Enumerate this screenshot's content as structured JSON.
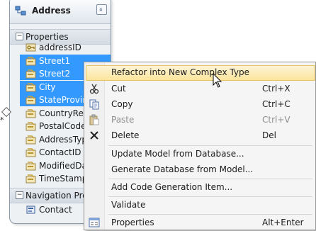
{
  "entity": {
    "title": "Address",
    "collapse_glyph": "»",
    "properties_header": "Properties",
    "navigation_header": "Navigation Prop",
    "properties": [
      {
        "label": "addressID",
        "icon": "key-property-icon",
        "selected": false
      },
      {
        "label": "Street1",
        "icon": "property-icon",
        "selected": true
      },
      {
        "label": "Street2",
        "icon": "property-icon",
        "selected": true
      },
      {
        "label": "City",
        "icon": "property-icon",
        "selected": true
      },
      {
        "label": "StateProvinc",
        "icon": "property-icon",
        "selected": true
      },
      {
        "label": "CountryRegi",
        "icon": "property-icon",
        "selected": false
      },
      {
        "label": "PostalCode",
        "icon": "property-icon",
        "selected": false
      },
      {
        "label": "AddressType",
        "icon": "property-icon",
        "selected": false
      },
      {
        "label": "ContactID",
        "icon": "property-icon",
        "selected": false
      },
      {
        "label": "ModifiedDat",
        "icon": "property-icon",
        "selected": false
      },
      {
        "label": "TimeStamp",
        "icon": "property-icon",
        "selected": false
      }
    ],
    "navigation": [
      {
        "label": "Contact",
        "icon": "navigation-property-icon"
      }
    ],
    "multiplicity": "*"
  },
  "context_menu": {
    "items": [
      {
        "label": "Refactor into New Complex Type",
        "shortcut": "",
        "icon": "",
        "highlighted": true,
        "disabled": false
      },
      {
        "label": "Cut",
        "shortcut": "Ctrl+X",
        "icon": "scissors-icon",
        "highlighted": false,
        "disabled": false
      },
      {
        "label": "Copy",
        "shortcut": "Ctrl+C",
        "icon": "copy-icon",
        "highlighted": false,
        "disabled": false
      },
      {
        "label": "Paste",
        "shortcut": "Ctrl+V",
        "icon": "paste-icon",
        "highlighted": false,
        "disabled": true
      },
      {
        "label": "Delete",
        "shortcut": "Del",
        "icon": "delete-x-icon",
        "highlighted": false,
        "disabled": false
      },
      {
        "label": "Update Model from Database...",
        "shortcut": "",
        "icon": "",
        "highlighted": false,
        "disabled": false
      },
      {
        "label": "Generate Database from Model...",
        "shortcut": "",
        "icon": "",
        "highlighted": false,
        "disabled": false
      },
      {
        "label": "Add Code Generation Item...",
        "shortcut": "",
        "icon": "",
        "highlighted": false,
        "disabled": false
      },
      {
        "label": "Validate",
        "shortcut": "",
        "icon": "",
        "highlighted": false,
        "disabled": false
      },
      {
        "label": "Properties",
        "shortcut": "Alt+Enter",
        "icon": "properties-icon",
        "highlighted": false,
        "disabled": false
      }
    ]
  },
  "colors": {
    "selection": "#3399ff",
    "menu_highlight": "#fce59c"
  }
}
